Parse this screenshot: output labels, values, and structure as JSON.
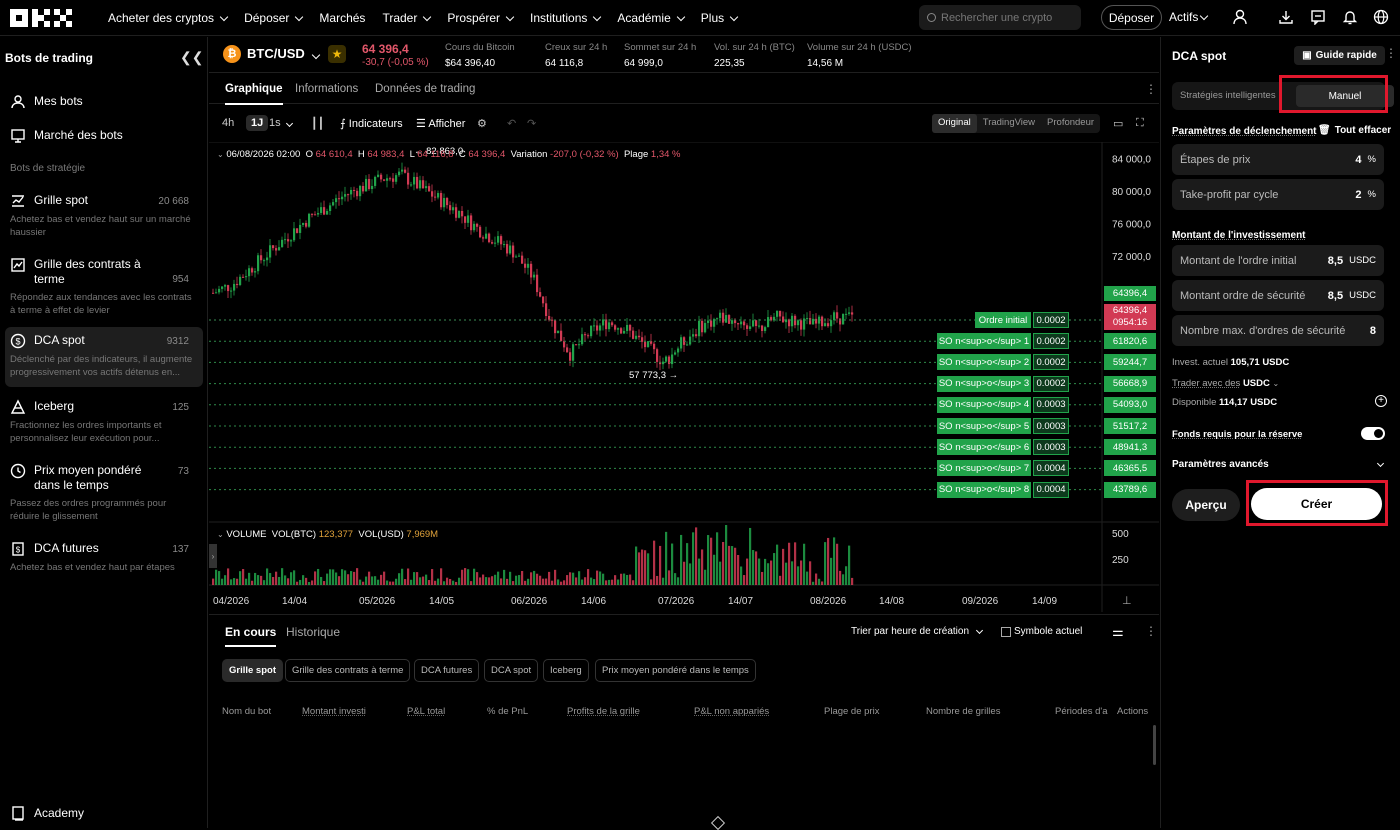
{
  "nav": {
    "logo": "OKX",
    "menu": [
      "Acheter des cryptos",
      "Déposer",
      "Marchés",
      "Trader",
      "Prospérer",
      "Institutions",
      "Académie",
      "Plus"
    ],
    "search_placeholder": "Rechercher une crypto",
    "deposit_button": "Déposer",
    "assets": "Actifs",
    "icons": [
      "user-icon",
      "download-icon",
      "chat-icon",
      "bell-icon",
      "globe-icon"
    ]
  },
  "sidebar": {
    "title": "Bots de trading",
    "my_bots": "Mes bots",
    "bot_market": "Marché des bots",
    "section": "Bots de stratégie",
    "bots": [
      {
        "name": "Grille spot",
        "count": "20 668",
        "desc": "Achetez bas et vendez haut sur un marché haussier"
      },
      {
        "name": "Grille des contrats à terme",
        "count": "954",
        "desc": "Répondez aux tendances avec les contrats à terme à effet de levier"
      },
      {
        "name": "DCA spot",
        "count": "9312",
        "desc": "Déclenché par des indicateurs, il augmente progressivement vos actifs détenus en..."
      },
      {
        "name": "Iceberg",
        "count": "125",
        "desc": "Fractionnez les ordres importants et personnalisez leur exécution pour..."
      },
      {
        "name": "Prix moyen pondéré dans le temps",
        "count": "73",
        "desc": "Passez des ordres programmés pour réduire le glissement"
      },
      {
        "name": "DCA futures",
        "count": "137",
        "desc": "Achetez bas et vendez haut par étapes"
      }
    ],
    "academy": "Academy"
  },
  "ticker": {
    "pair": "BTC/USD",
    "price": "64 396,4",
    "change": "-30,7 (-0,05 %)",
    "stats": [
      {
        "label": "Cours du Bitcoin",
        "value": "$64 396,40"
      },
      {
        "label": "Creux sur 24 h",
        "value": "64 116,8"
      },
      {
        "label": "Sommet sur 24 h",
        "value": "64 999,0"
      },
      {
        "label": "Vol. sur 24 h (BTC)",
        "value": "225,35"
      },
      {
        "label": "Volume sur 24 h (USDC)",
        "value": "14,56 M"
      }
    ]
  },
  "chart_tabs": [
    "Graphique",
    "Informations",
    "Données de trading"
  ],
  "toolbar": {
    "intervals": [
      "4h",
      "1J",
      "1s"
    ],
    "indicators": "Indicateurs",
    "display": "Afficher",
    "views": [
      "Original",
      "TradingView",
      "Profondeur"
    ]
  },
  "ohlc": {
    "date": "06/08/2026 02:00",
    "o_label": "O",
    "o": "64 610,4",
    "h_label": "H",
    "h": "64 983,4",
    "l_label": "L",
    "l": "64 116,8",
    "c_label": "C",
    "c": "64 396,4",
    "var_label": "Variation",
    "var": "-207,0 (-0,32 %)",
    "range_label": "Plage",
    "range": "1,34 %"
  },
  "volume": {
    "label": "VOLUME",
    "btc_label": "VOL(BTC)",
    "btc": "123,377",
    "usd_label": "VOL(USD)",
    "usd": "7,969M"
  },
  "chart_data": {
    "type": "candlestick",
    "x_ticks": [
      "04/2026",
      "14/04",
      "05/2026",
      "14/05",
      "06/2026",
      "14/06",
      "07/2026",
      "14/07",
      "08/2026",
      "14/08",
      "09/2026",
      "14/09"
    ],
    "y_ticks": [
      84000,
      80000,
      76000,
      72000
    ],
    "y_tick_labels": [
      "84 000,0",
      "80 000,0",
      "76 000,0",
      "72 000,0"
    ],
    "ylim": [
      40000,
      86000
    ],
    "vol_ticks": [
      "500",
      "250"
    ],
    "high_marker": "← 82 863,0",
    "low_marker": "57 773,3 →",
    "last_price": "64396,4",
    "last_price_top": "64396,4",
    "countdown": "0954:16",
    "orders": [
      {
        "label": "Ordre initial",
        "qty": "0.0002",
        "price": ""
      },
      {
        "label": "SO n<sup>o</sup> 1",
        "qty": "0.0002",
        "price": "61820,6"
      },
      {
        "label": "SO n<sup>o</sup> 2",
        "qty": "0.0002",
        "price": "59244,7"
      },
      {
        "label": "SO n<sup>o</sup> 3",
        "qty": "0.0002",
        "price": "56668,9"
      },
      {
        "label": "SO n<sup>o</sup> 4",
        "qty": "0.0003",
        "price": "54093,0"
      },
      {
        "label": "SO n<sup>o</sup> 5",
        "qty": "0.0003",
        "price": "51517,2"
      },
      {
        "label": "SO n<sup>o</sup> 6",
        "qty": "0.0003",
        "price": "48941,3"
      },
      {
        "label": "SO n<sup>o</sup> 7",
        "qty": "0.0004",
        "price": "46365,5"
      },
      {
        "label": "SO n<sup>o</sup> 8",
        "qty": "0.0004",
        "price": "43789,6"
      }
    ],
    "series": [
      {
        "values": [
          67500,
          68500,
          70500,
          72500,
          74500,
          76500,
          78000,
          79500,
          80500,
          81500,
          82000,
          80500,
          79000,
          77500,
          75500,
          74000,
          72500,
          69500,
          64000,
          60000,
          62500,
          64000,
          63000,
          61000,
          59000,
          61500,
          63500,
          64500,
          64000,
          63000,
          64500,
          64000,
          63500,
          64500,
          64400
        ]
      }
    ]
  },
  "bottom": {
    "tabs": [
      "En cours",
      "Historique"
    ],
    "sort": "Trier par heure de création",
    "current_symbol": "Symbole actuel",
    "chips": [
      "Grille spot",
      "Grille des contrats à terme",
      "DCA futures",
      "DCA spot",
      "Iceberg",
      "Prix moyen pondéré dans le temps"
    ],
    "columns": [
      "Nom du bot",
      "Montant investi",
      "P&L total",
      "% de PnL",
      "Profits de la grille",
      "P&L non appariés",
      "Plage de prix",
      "Nombre de grilles",
      "Périodes d'ar",
      "Actions"
    ]
  },
  "right": {
    "title": "DCA spot",
    "guide": "Guide rapide",
    "seg": [
      "Stratégies intelligentes",
      "Manuel"
    ],
    "trigger_title": "Paramètres de déclenchement",
    "clear_all": "Tout effacer",
    "fields": [
      {
        "label": "Étapes de prix",
        "value": "4",
        "unit": "%"
      },
      {
        "label": "Take-profit par cycle",
        "value": "2",
        "unit": "%"
      }
    ],
    "invest_title": "Montant de l'investissement",
    "invest_fields": [
      {
        "label": "Montant de l'ordre initial",
        "value": "8,5",
        "unit": "USDC"
      },
      {
        "label": "Montant ordre de sécurité",
        "value": "8,5",
        "unit": "USDC"
      },
      {
        "label": "Nombre max. d'ordres de sécurité",
        "value": "8",
        "unit": ""
      }
    ],
    "invest_actual_label": "Invest. actuel",
    "invest_actual": "105,71 USDC",
    "trade_with_label": "Trader avec des",
    "trade_with": "USDC",
    "available_label": "Disponible",
    "available": "114,17 USDC",
    "reserve": "Fonds requis pour la réserve",
    "advanced": "Paramètres avancés",
    "preview": "Aperçu",
    "create": "Créer"
  }
}
